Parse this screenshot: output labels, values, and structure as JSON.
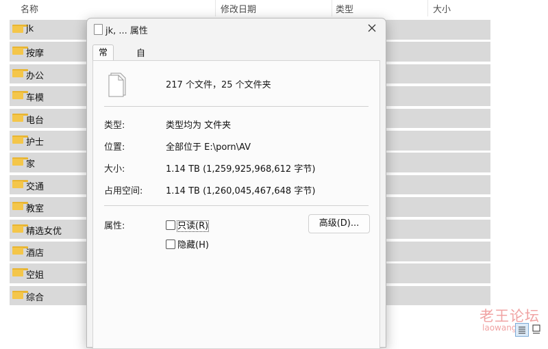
{
  "explorer": {
    "columns": [
      "名称",
      "修改日期",
      "类型",
      "大小"
    ],
    "folders": [
      "jk",
      "按摩",
      "办公",
      "车模",
      "电台",
      "护士",
      "家",
      "交通",
      "教室",
      "精选女优",
      "酒店",
      "空姐",
      "综合"
    ],
    "folder_icon": "folder-icon",
    "folder_color": "#f4c64a",
    "row_color": "#d9d9d9"
  },
  "dialog": {
    "title": "jk, ... 属性",
    "close_icon": "close-icon",
    "tabs": [
      "常规",
      "自定义"
    ],
    "summary": "217 个文件，25 个文件夹",
    "props": [
      {
        "label": "类型:",
        "value": "类型均为 文件夹"
      },
      {
        "label": "位置:",
        "value": "全部位于 E:\\porn\\AV"
      },
      {
        "label": "大小:",
        "value": "1.14 TB (1,259,925,968,612 字节)"
      },
      {
        "label": "占用空间:",
        "value": "1.14 TB (1,260,045,467,648 字节)"
      }
    ],
    "attributes_label": "属性:",
    "readonly_label": "只读(R)",
    "hidden_label": "隐藏(H)",
    "advanced_label": "高级(D)..."
  },
  "watermark": {
    "cn": "老王论坛",
    "en": "laowang"
  }
}
